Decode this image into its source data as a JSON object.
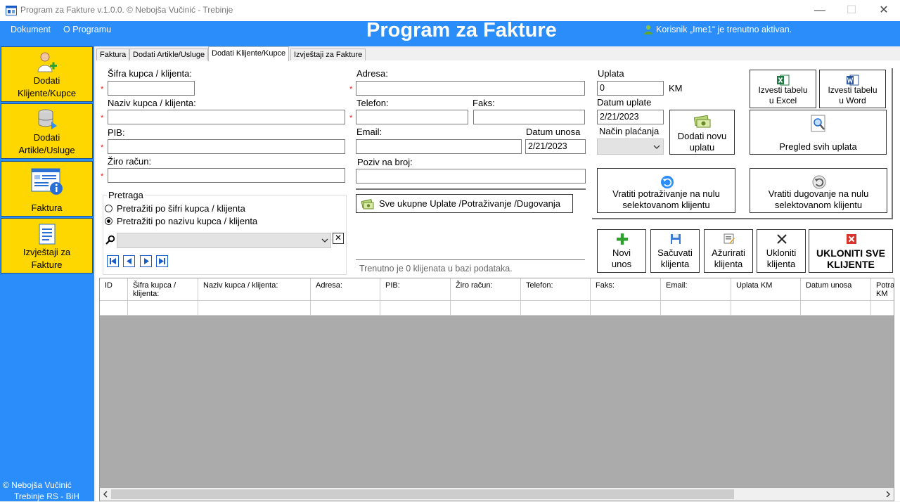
{
  "window": {
    "title": "Program za Fakture v.1.0.0. ©  Nebojša Vučinić - Trebinje",
    "minimize": "—",
    "maximize": "☐",
    "close": "✕"
  },
  "header": {
    "menu": [
      "Dokument",
      "O Programu"
    ],
    "app_title": "Program za Fakture",
    "user_status": "Korisnik „Ime1“ je trenutno aktivan."
  },
  "sidebar": {
    "items": [
      {
        "label_line1": "Dodati",
        "label_line2": "Klijente/Kupce",
        "icon": "add-user-icon"
      },
      {
        "label_line1": "Dodati",
        "label_line2": "Artikle/Usluge",
        "icon": "database-icon"
      },
      {
        "label_line1": "Faktura",
        "label_line2": "",
        "icon": "invoice-info-icon"
      },
      {
        "label_line1": "Izvještaji za",
        "label_line2": "Fakture",
        "icon": "report-icon"
      }
    ],
    "footer_line1": "©  Nebojša Vučinić",
    "footer_line2": "Trebinje  RS - BiH"
  },
  "tabs": [
    "Faktura",
    "Dodati Artikle/Usluge",
    "Dodati Klijente/Kupce",
    "Izvještaji za Fakture"
  ],
  "active_tab": "Dodati Klijente/Kupce",
  "form": {
    "sifra_label": "Šifra kupca / klijenta:",
    "naziv_label": "Naziv kupca / klijenta:",
    "pib_label": "PIB:",
    "ziro_label": "Žiro račun:",
    "adresa_label": "Adresa:",
    "telefon_label": "Telefon:",
    "faks_label": "Faks:",
    "email_label": "Email:",
    "datum_unosa_label": "Datum unosa",
    "datum_unosa_value": "2/21/2023",
    "poziv_label": "Poziv na broj:",
    "required_mark": "*"
  },
  "search": {
    "group_label": "Pretraga",
    "option_sifra": "Pretražiti po šifri kupca / klijenta",
    "option_naziv": "Pretražiti po nazivu kupca / klijenta",
    "selected": "naziv",
    "clear": "✕"
  },
  "totals_button": "Sve ukupne Uplate /Potraživanje /Dugovanja",
  "status_text": "Trenutno je 0 klijenata u bazi podataka.",
  "payment": {
    "uplata_label": "Uplata",
    "uplata_value": "0",
    "currency": "KM",
    "datum_uplate_label": "Datum uplate",
    "datum_uplate_value": "2/21/2023",
    "nacin_label": "Način plaćanja",
    "add_button_line1": "Dodati novu",
    "add_button_line2": "uplatu"
  },
  "export": {
    "excel_line1": "Izvesti tabelu",
    "excel_line2": "u Excel",
    "word_line1": "Izvesti tabelu",
    "word_line2": "u Word",
    "pregled": "Pregled svih uplata"
  },
  "reset": {
    "potrazivanje_line1": "Vratiti potraživanje na nulu",
    "potrazivanje_line2": "selektovanom klijentu",
    "dugovanje_line1": "Vratiti dugovanje na nulu",
    "dugovanje_line2": "selektovanom klijentu"
  },
  "actions": {
    "novi_line1": "Novi",
    "novi_line2": "unos",
    "sacuvati_line1": "Sačuvati",
    "sacuvati_line2": "klijenta",
    "azurirati_line1": "Ažurirati",
    "azurirati_line2": "klijenta",
    "ukloniti_line1": "Ukloniti",
    "ukloniti_line2": "klijenta",
    "ukloniti_sve_line1": "UKLONITI SVE",
    "ukloniti_sve_line2": "KLIJENTE"
  },
  "table": {
    "columns": [
      {
        "line1": "ID",
        "line2": ""
      },
      {
        "line1": "Šifra kupca /",
        "line2": "klijenta:"
      },
      {
        "line1": "Naziv kupca / klijenta:",
        "line2": ""
      },
      {
        "line1": "Adresa:",
        "line2": ""
      },
      {
        "line1": "PIB:",
        "line2": ""
      },
      {
        "line1": "Žiro račun:",
        "line2": ""
      },
      {
        "line1": "Telefon:",
        "line2": ""
      },
      {
        "line1": "Faks:",
        "line2": ""
      },
      {
        "line1": "Email:",
        "line2": ""
      },
      {
        "line1": "Uplata KM",
        "line2": ""
      },
      {
        "line1": "Datum unosa",
        "line2": ""
      },
      {
        "line1": "Potra",
        "line2": "KM"
      }
    ]
  },
  "colors": {
    "accent_blue": "#2a8dfa",
    "sidebar_button": "#ffd700",
    "required_red": "#e11111"
  }
}
